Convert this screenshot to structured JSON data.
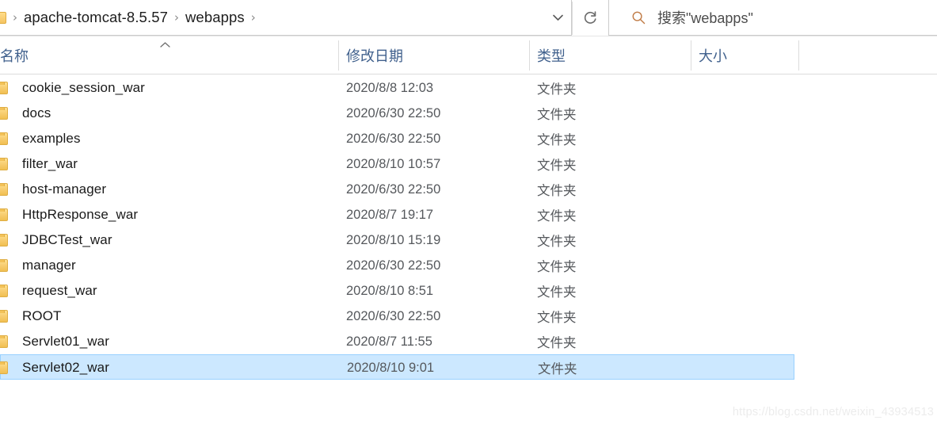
{
  "addressbar": {
    "breadcrumbs": [
      {
        "label": "apache-tomcat-8.5.57"
      },
      {
        "label": "webapps"
      }
    ],
    "separator": "›",
    "dropdown_icon": "chevron-down-icon",
    "refresh_icon": "refresh-icon",
    "search": {
      "icon": "search-icon",
      "placeholder": "搜索\"webapps\""
    }
  },
  "columns": [
    {
      "key": "name",
      "label": "名称",
      "sorted": "asc",
      "sort_glyph": "▲"
    },
    {
      "key": "date",
      "label": "修改日期"
    },
    {
      "key": "type",
      "label": "类型"
    },
    {
      "key": "size",
      "label": "大小"
    }
  ],
  "files": [
    {
      "name": "cookie_session_war",
      "date": "2020/8/8 12:03",
      "type": "文件夹",
      "size": "",
      "selected": false
    },
    {
      "name": "docs",
      "date": "2020/6/30 22:50",
      "type": "文件夹",
      "size": "",
      "selected": false
    },
    {
      "name": "examples",
      "date": "2020/6/30 22:50",
      "type": "文件夹",
      "size": "",
      "selected": false
    },
    {
      "name": "filter_war",
      "date": "2020/8/10 10:57",
      "type": "文件夹",
      "size": "",
      "selected": false
    },
    {
      "name": "host-manager",
      "date": "2020/6/30 22:50",
      "type": "文件夹",
      "size": "",
      "selected": false
    },
    {
      "name": "HttpResponse_war",
      "date": "2020/8/7 19:17",
      "type": "文件夹",
      "size": "",
      "selected": false
    },
    {
      "name": "JDBCTest_war",
      "date": "2020/8/10 15:19",
      "type": "文件夹",
      "size": "",
      "selected": false
    },
    {
      "name": "manager",
      "date": "2020/6/30 22:50",
      "type": "文件夹",
      "size": "",
      "selected": false
    },
    {
      "name": "request_war",
      "date": "2020/8/10 8:51",
      "type": "文件夹",
      "size": "",
      "selected": false
    },
    {
      "name": "ROOT",
      "date": "2020/6/30 22:50",
      "type": "文件夹",
      "size": "",
      "selected": false
    },
    {
      "name": "Servlet01_war",
      "date": "2020/8/7 11:55",
      "type": "文件夹",
      "size": "",
      "selected": false
    },
    {
      "name": "Servlet02_war",
      "date": "2020/8/10 9:01",
      "type": "文件夹",
      "size": "",
      "selected": true
    }
  ],
  "watermark": "https://blog.csdn.net/weixin_43934513",
  "colors": {
    "selection_fill": "#cce8ff",
    "selection_border": "#99d1ff",
    "header_text": "#41618d",
    "folder_icon": "#f3c258",
    "search_icon": "#c07b46",
    "body_text": "#1a1a1a",
    "secondary_text": "#55585c",
    "watermark_text": "#ececec"
  }
}
